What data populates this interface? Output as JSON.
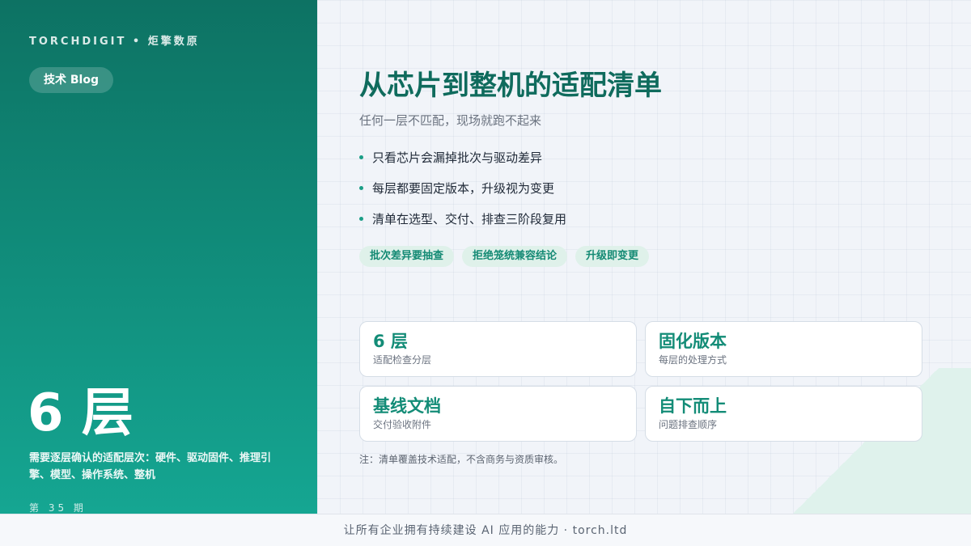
{
  "left_panel": {
    "brand": "TORCHDIGIT • 炬擎数原",
    "tag": "技术 Blog",
    "big_stat": "6 层",
    "big_stat_desc": "需要逐层确认的适配层次：硬件、驱动固件、推理引擎、模型、操作系统、整机",
    "issue": "第 35 期"
  },
  "main": {
    "title": "从芯片到整机的适配清单",
    "subtitle": "任何一层不匹配，现场就跑不起来",
    "bullets": [
      "只看芯片会漏掉批次与驱动差异",
      "每层都要固定版本，升级视为变更",
      "清单在选型、交付、排查三阶段复用"
    ],
    "chips": [
      "批次差异要抽查",
      "拒绝笼统兼容结论",
      "升级即变更"
    ],
    "cards": [
      {
        "value": "6 层",
        "label": "适配检查分层"
      },
      {
        "value": "固化版本",
        "label": "每层的处理方式"
      },
      {
        "value": "基线文档",
        "label": "交付验收附件"
      },
      {
        "value": "自下而上",
        "label": "问题排查顺序"
      }
    ],
    "note": "注：清单覆盖技术适配，不含商务与资质审核。"
  },
  "footer": {
    "text": "让所有企业拥有持续建设 AI 应用的能力 · torch.ltd"
  },
  "colors": {
    "accent": "#138c77",
    "title": "#0f6b5d",
    "panel_top": "#0d7263",
    "panel_bottom": "#15a692",
    "chip_bg": "#dff1ea"
  }
}
